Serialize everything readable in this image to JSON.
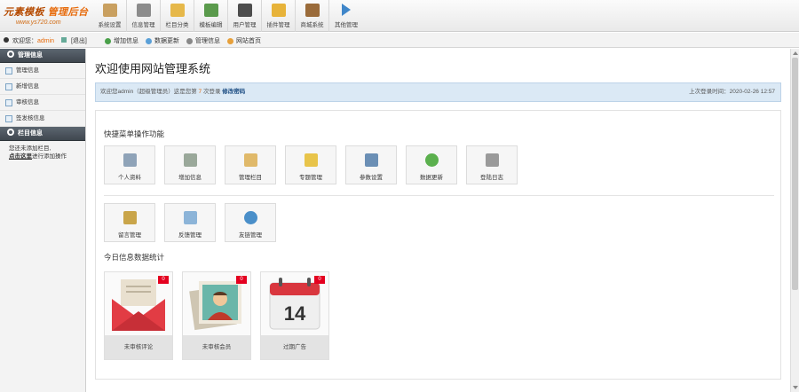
{
  "logo": {
    "title_a": "元素模板",
    "title_b": "管理后台",
    "site": "www.ys720.com"
  },
  "topnav": [
    {
      "label": "系统设置",
      "icon": "system-settings-icon",
      "color": "#c9a060"
    },
    {
      "label": "信息管理",
      "icon": "info-manage-icon",
      "color": "#8c8c8c"
    },
    {
      "label": "栏目分类",
      "icon": "category-icon",
      "color": "#e6b84a"
    },
    {
      "label": "模板编辑",
      "icon": "template-edit-icon",
      "color": "#5a9a4c"
    },
    {
      "label": "用户管理",
      "icon": "user-manage-icon",
      "color": "#4d4d4d"
    },
    {
      "label": "插件管理",
      "icon": "plugin-icon",
      "color": "#e7b33a"
    },
    {
      "label": "商城系统",
      "icon": "shop-icon",
      "color": "#9a6b3a"
    },
    {
      "label": "其他管理",
      "icon": "other-icon",
      "color": "#3f86c9"
    }
  ],
  "subbar": {
    "welcome": "欢迎您：",
    "user": "admin",
    "logout": "[退出]",
    "quick": [
      {
        "label": "增加信息",
        "color": "#4aa04a"
      },
      {
        "label": "数据更新",
        "color": "#5aa0d8"
      },
      {
        "label": "管理信息",
        "color": "#888888"
      },
      {
        "label": "网站首页",
        "color": "#e7a03a"
      }
    ]
  },
  "sidebar": {
    "section1": "管理信息",
    "items": [
      "管理信息",
      "新增信息",
      "审核信息",
      "签发核信息"
    ],
    "section2": "栏目信息",
    "note_1": "您还未添加栏目,",
    "note_link": "点击这里",
    "note_2": "进行添加操作"
  },
  "main": {
    "title": "欢迎使用网站管理系统",
    "info_prefix": "欢迎您admin（超级管理员）这是您第",
    "info_count": "7",
    "info_suffix": "次登录",
    "info_change": "修改密码",
    "info_last": "上次登录时间：2020-02-26 12:57",
    "quick_title": "快捷菜单操作功能",
    "tiles_row1": [
      {
        "label": "个人资料",
        "icon": "profile-icon",
        "color": "#8fa3b8"
      },
      {
        "label": "增加信息",
        "icon": "add-info-icon",
        "color": "#9aa89a"
      },
      {
        "label": "管理栏目",
        "icon": "manage-column-icon",
        "color": "#e0b96a"
      },
      {
        "label": "专题管理",
        "icon": "topic-icon",
        "color": "#e8c44a"
      },
      {
        "label": "参数设置",
        "icon": "params-icon",
        "color": "#6b8fb5"
      },
      {
        "label": "数据更新",
        "icon": "recycle-icon",
        "color": "#5bb04e"
      },
      {
        "label": "登陆日志",
        "icon": "login-log-icon",
        "color": "#9a9a9a"
      }
    ],
    "tiles_row2": [
      {
        "label": "留言管理",
        "icon": "message-icon",
        "color": "#c9a54a"
      },
      {
        "label": "反馈管理",
        "icon": "feedback-icon",
        "color": "#8cb4d8"
      },
      {
        "label": "友链管理",
        "icon": "globe-icon",
        "color": "#4a8fc9"
      }
    ],
    "stats_title": "今日信息数据统计",
    "stats": [
      {
        "label": "未审核评论",
        "count": "0",
        "icon": "mail-icon"
      },
      {
        "label": "未审核会员",
        "count": "0",
        "icon": "member-photo-icon"
      },
      {
        "label": "过期广告",
        "count": "0",
        "icon": "calendar-icon",
        "day": "14"
      }
    ]
  }
}
